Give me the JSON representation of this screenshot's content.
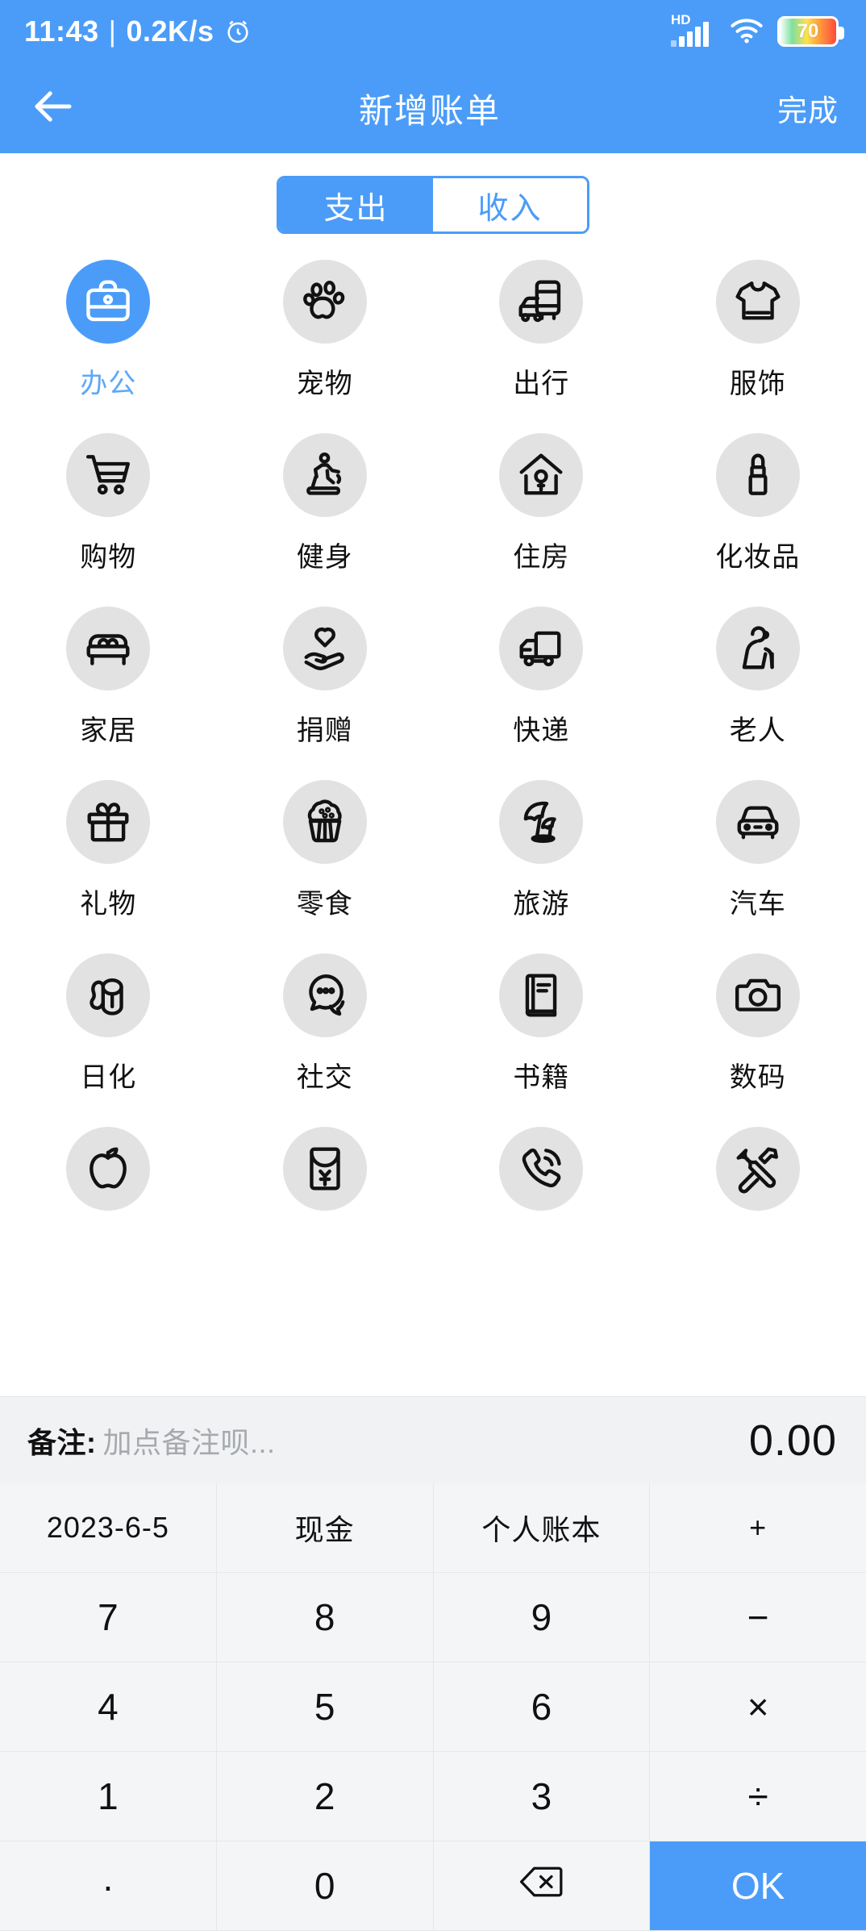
{
  "status_bar": {
    "time": "11:43",
    "separator": "|",
    "net_speed": "0.2K/s",
    "alarm_icon": "alarm-clock-icon",
    "hd_label": "HD",
    "signal_icon": "signal-bars-icon",
    "wifi_icon": "wifi-icon",
    "battery_level": "70",
    "battery_icon": "battery-icon"
  },
  "header": {
    "back_icon": "back-arrow-icon",
    "title": "新增账单",
    "action_label": "完成"
  },
  "segmented": {
    "expense_label": "支出",
    "income_label": "收入",
    "selected": "支出"
  },
  "categories": {
    "selected": "办公",
    "items": [
      {
        "label": "办公",
        "icon": "briefcase-icon",
        "selected": true
      },
      {
        "label": "宠物",
        "icon": "paw-print-icon",
        "selected": false
      },
      {
        "label": "出行",
        "icon": "bus-car-icon",
        "selected": false
      },
      {
        "label": "服饰",
        "icon": "tshirt-icon",
        "selected": false
      },
      {
        "label": "购物",
        "icon": "shopping-cart-icon",
        "selected": false
      },
      {
        "label": "健身",
        "icon": "treadmill-icon",
        "selected": false
      },
      {
        "label": "住房",
        "icon": "house-key-icon",
        "selected": false
      },
      {
        "label": "化妆品",
        "icon": "lipstick-icon",
        "selected": false
      },
      {
        "label": "家居",
        "icon": "bed-icon",
        "selected": false
      },
      {
        "label": "捐赠",
        "icon": "heart-hand-icon",
        "selected": false
      },
      {
        "label": "快递",
        "icon": "delivery-truck-icon",
        "selected": false
      },
      {
        "label": "老人",
        "icon": "elderly-person-icon",
        "selected": false
      },
      {
        "label": "礼物",
        "icon": "gift-box-icon",
        "selected": false
      },
      {
        "label": "零食",
        "icon": "cupcake-icon",
        "selected": false
      },
      {
        "label": "旅游",
        "icon": "beach-umbrella-icon",
        "selected": false
      },
      {
        "label": "汽车",
        "icon": "car-icon",
        "selected": false
      },
      {
        "label": "日化",
        "icon": "toilet-paper-icon",
        "selected": false
      },
      {
        "label": "社交",
        "icon": "chat-bubbles-icon",
        "selected": false
      },
      {
        "label": "书籍",
        "icon": "book-icon",
        "selected": false
      },
      {
        "label": "数码",
        "icon": "camera-icon",
        "selected": false
      },
      {
        "label": "",
        "icon": "apple-icon",
        "selected": false
      },
      {
        "label": "",
        "icon": "red-envelope-icon",
        "selected": false
      },
      {
        "label": "",
        "icon": "phone-call-icon",
        "selected": false
      },
      {
        "label": "",
        "icon": "tools-icon",
        "selected": false
      }
    ]
  },
  "note_bar": {
    "note_label": "备注:",
    "note_placeholder": "加点备注呗...",
    "note_value": "",
    "amount": "0.00"
  },
  "keypad": {
    "meta_row": [
      {
        "label": "2023-6-5",
        "name": "date-key"
      },
      {
        "label": "现金",
        "name": "account-type-key"
      },
      {
        "label": "个人账本",
        "name": "ledger-key"
      },
      {
        "label": "+",
        "name": "plus-key"
      }
    ],
    "row_789": [
      {
        "label": "7",
        "name": "key-7"
      },
      {
        "label": "8",
        "name": "key-8"
      },
      {
        "label": "9",
        "name": "key-9"
      },
      {
        "label": "−",
        "name": "key-minus"
      }
    ],
    "row_456": [
      {
        "label": "4",
        "name": "key-4"
      },
      {
        "label": "5",
        "name": "key-5"
      },
      {
        "label": "6",
        "name": "key-6"
      },
      {
        "label": "×",
        "name": "key-multiply"
      }
    ],
    "row_123": [
      {
        "label": "1",
        "name": "key-1"
      },
      {
        "label": "2",
        "name": "key-2"
      },
      {
        "label": "3",
        "name": "key-3"
      },
      {
        "label": "÷",
        "name": "key-divide"
      }
    ],
    "row_last": [
      {
        "label": "·",
        "name": "key-dot"
      },
      {
        "label": "0",
        "name": "key-0"
      },
      {
        "label": "",
        "name": "key-backspace"
      },
      {
        "label": "OK",
        "name": "key-ok"
      }
    ]
  },
  "colors": {
    "brand_blue": "#4b9cf8",
    "circle_gray": "#e2e2e2",
    "keypad_bg": "#f4f5f7",
    "note_bg": "#f1f2f4"
  }
}
